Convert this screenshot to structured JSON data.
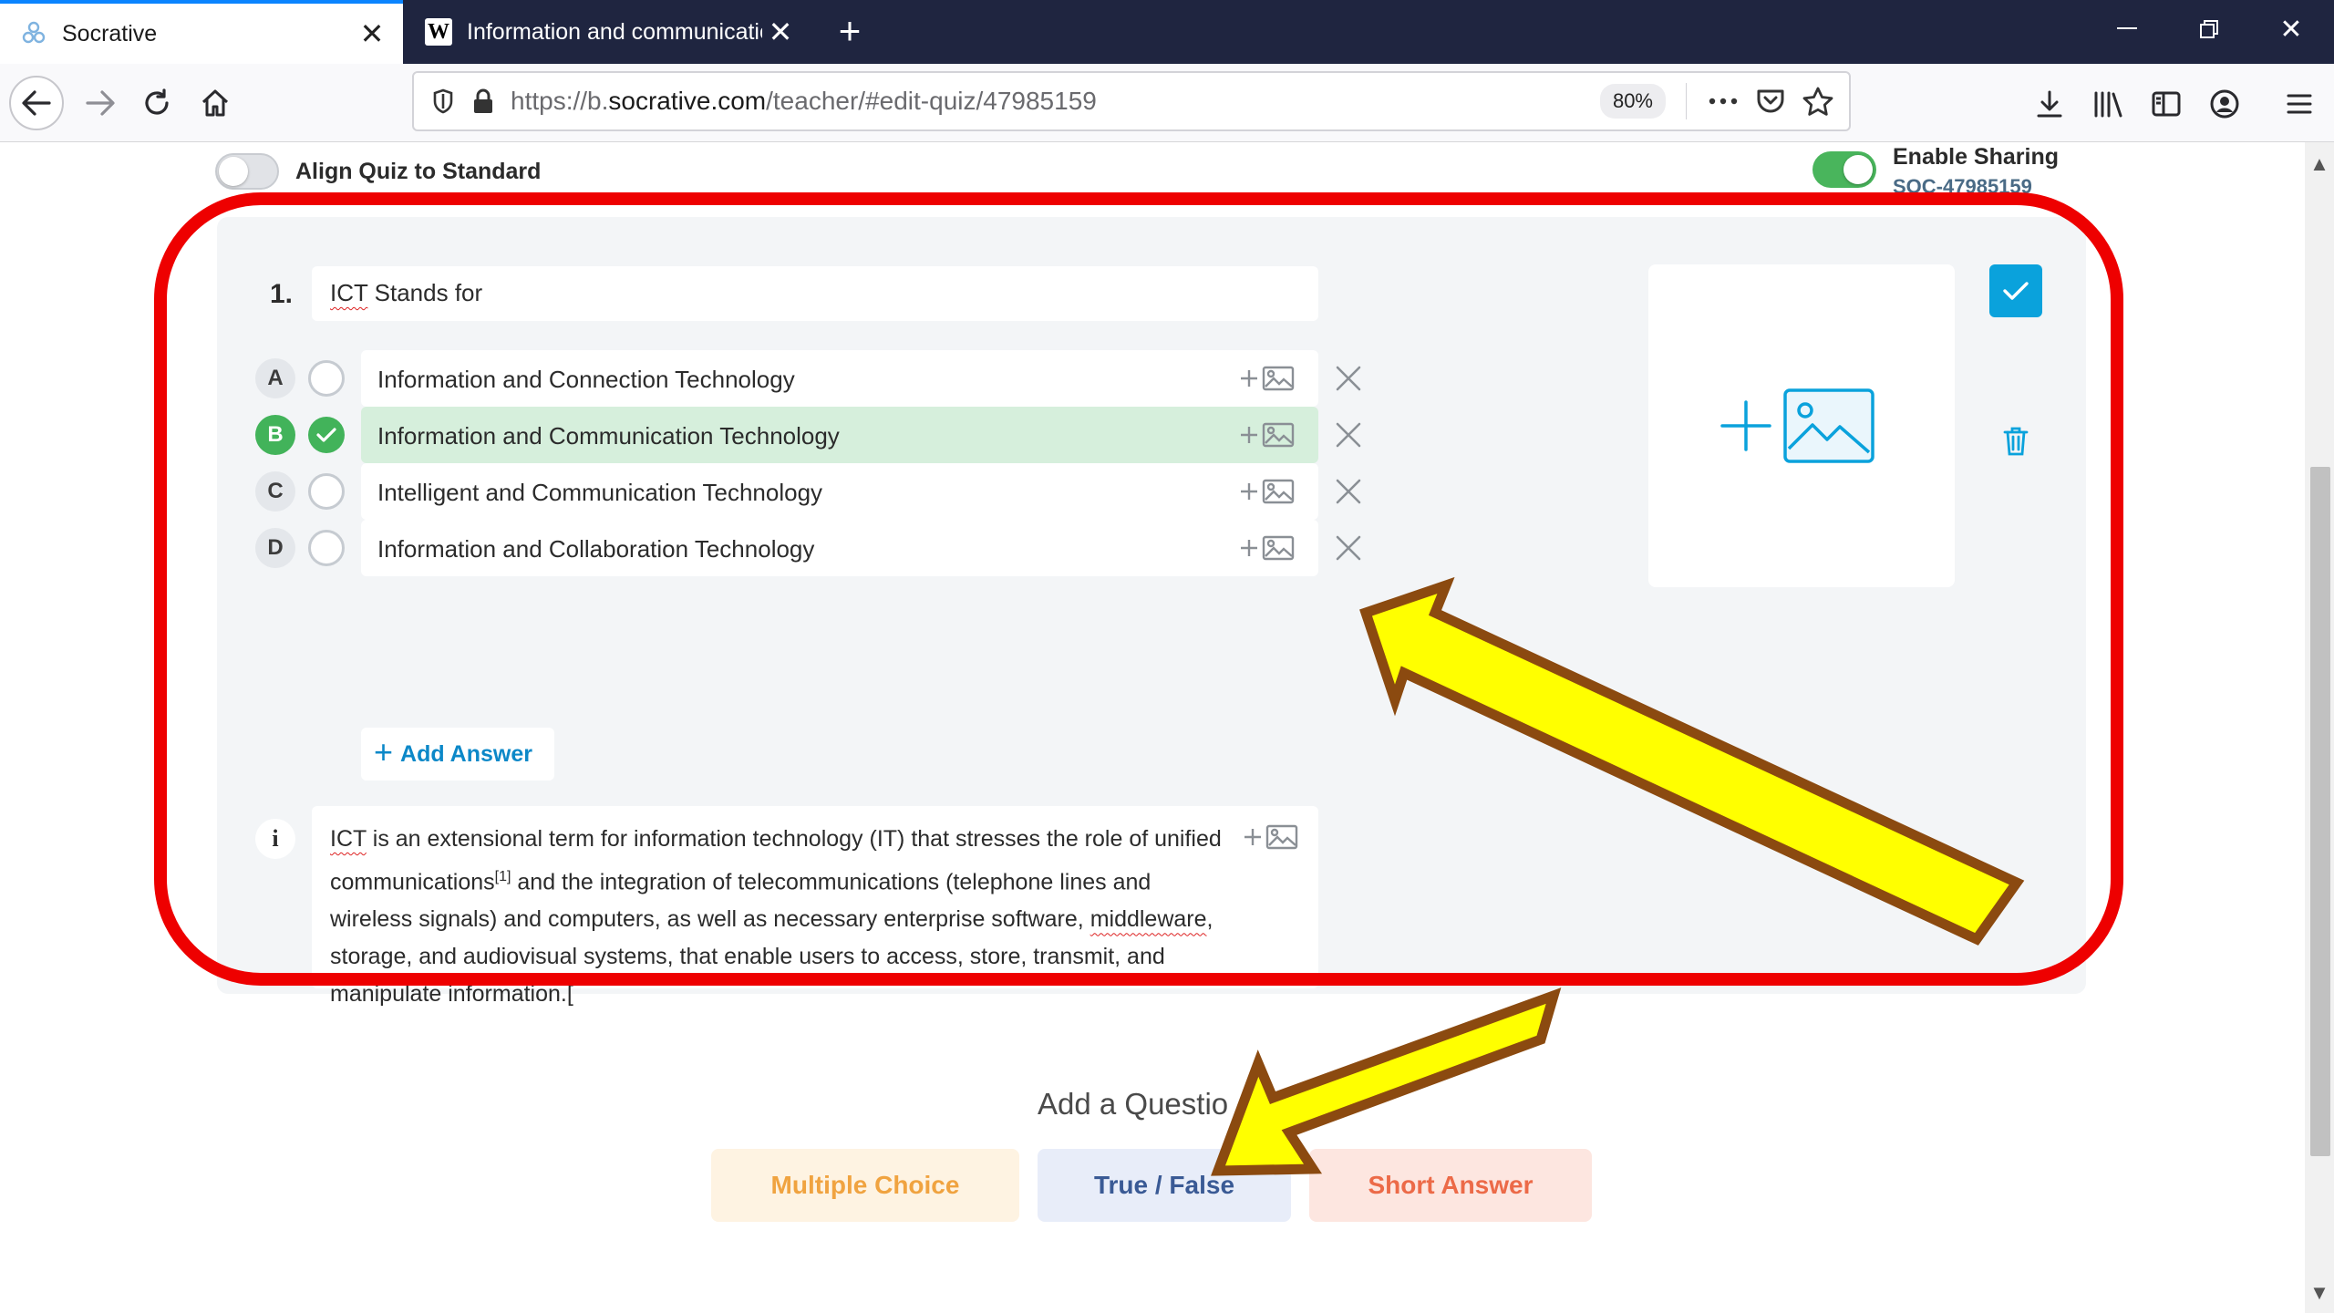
{
  "browser": {
    "tabs": [
      {
        "title": "Socrative",
        "active": true,
        "favicon": "socrative-logo-icon"
      },
      {
        "title": "Information and communicatio",
        "active": false,
        "favicon": "wikipedia-w-icon",
        "favicon_glyph": "W"
      }
    ],
    "url_prefix": "https://b.",
    "url_domain": "socrative.com",
    "url_suffix": "/teacher/#edit-quiz/47985159",
    "zoom": "80%"
  },
  "quiz": {
    "align_label": "Align Quiz to Standard",
    "align_enabled": false,
    "sharing_label": "Enable Sharing",
    "sharing_enabled": true,
    "share_code": "SOC-47985159",
    "question": {
      "number": "1.",
      "text_part1": "ICT",
      "text_part2": " Stands for",
      "answers": [
        {
          "letter": "A",
          "text": "Information and Connection Technology",
          "correct": false
        },
        {
          "letter": "B",
          "text": "Information and Communication Technology",
          "correct": true
        },
        {
          "letter": "C",
          "text": "Intelligent and Communication Technology",
          "correct": false
        },
        {
          "letter": "D",
          "text": "Information and Collaboration Technology",
          "correct": false
        }
      ],
      "add_answer_label": "Add Answer",
      "add_answer_plus": "+",
      "info_icon": "i",
      "explanation": {
        "p1": "ICT",
        "p2": " is an extensional term for information technology (IT) that stresses the role of unified communications",
        "sup": "[1]",
        "p3": " and the integration of telecommunications (telephone lines and wireless signals) and computers, as well as necessary enterprise software, ",
        "p4": "middleware",
        "p5": ", storage, and audiovisual systems, that enable users to access, store, transmit, and manipulate information.["
      }
    }
  },
  "add_question": {
    "title": "Add a Questio",
    "types": [
      "Multiple Choice",
      "True / False",
      "Short Answer"
    ]
  },
  "colors": {
    "accent": "#0aa2dc",
    "correct": "#42b35a",
    "highlight_ring": "#ee0000",
    "arrow_fill": "#ffff00",
    "arrow_stroke": "#8b4a10"
  }
}
